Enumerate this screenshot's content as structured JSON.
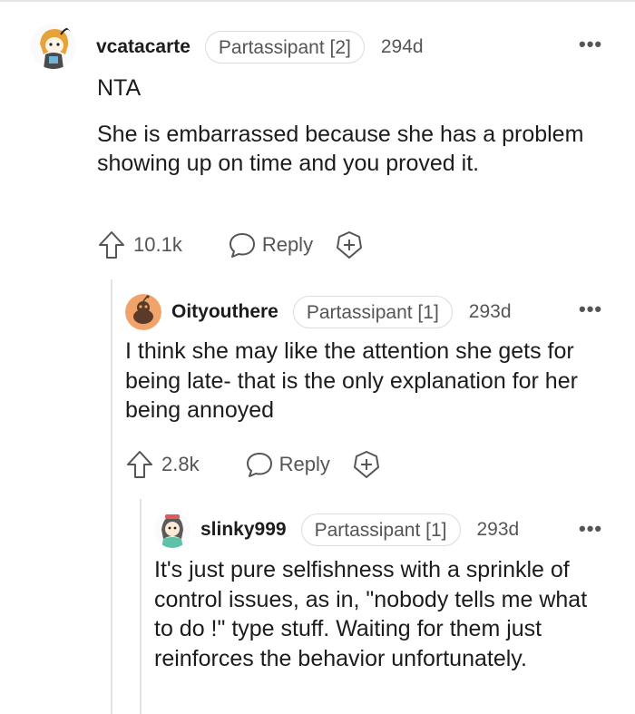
{
  "comments": [
    {
      "username": "vcatacarte",
      "flair": "Partassipant [2]",
      "age": "294d",
      "paragraphs": [
        "NTA",
        "She is embarrassed because she has a problem showing up on time and you proved it."
      ],
      "upvotes": "10.1k",
      "reply_label": "Reply"
    },
    {
      "username": "Oityouthere",
      "flair": "Partassipant [1]",
      "age": "293d",
      "paragraphs": [
        "I think she may like the attention she gets for being late- that is the only explanation for her being annoyed"
      ],
      "upvotes": "2.8k",
      "reply_label": "Reply"
    },
    {
      "username": "slinky999",
      "flair": "Partassipant [1]",
      "age": "293d",
      "paragraphs": [
        "It's just pure selfishness with a sprinkle of control issues, as in, \"nobody tells me what to do !\" type stuff. Waiting for them just reinforces the behavior unfortunately."
      ]
    }
  ],
  "more_label": "•••",
  "colors": {
    "text": "#1c1c1c",
    "muted": "#555555",
    "border": "#dcdcdc",
    "thread": "#e3e3e3",
    "avatar_orange": "#f0a36a"
  }
}
